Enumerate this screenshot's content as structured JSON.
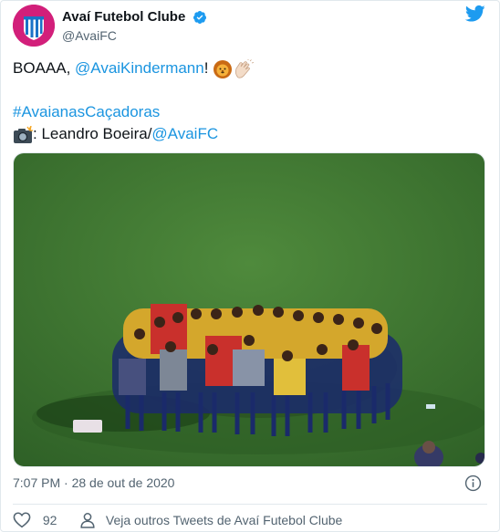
{
  "tweet": {
    "display_name": "Avaí Futebol Clube",
    "handle": "@AvaiFC",
    "verified_icon": "verified-badge-icon",
    "brand_icon": "twitter-bird-icon",
    "text": {
      "line1_prefix": "BOAAA, ",
      "line1_mention": "@AvaiKindermann",
      "line1_suffix": "! ",
      "line1_emojis": [
        "lion-face-emoji",
        "clapping-hands-emoji"
      ],
      "hashtag": "#AvaianasCaçadoras",
      "credit_emoji": "camera-flash-emoji",
      "credit_text": ": Leandro Boeira/",
      "credit_mention": "@AvaiFC"
    },
    "timestamp": "7:07 PM · 28 de out de 2020",
    "likes": "92",
    "more_tweets": "Veja outros Tweets de Avaí Futebol Clube"
  },
  "colors": {
    "link": "#1b95e0",
    "avatar_bg": "#d21f7a",
    "text": "#0f1419",
    "muted": "#536471",
    "border": "#e1e8ed"
  }
}
